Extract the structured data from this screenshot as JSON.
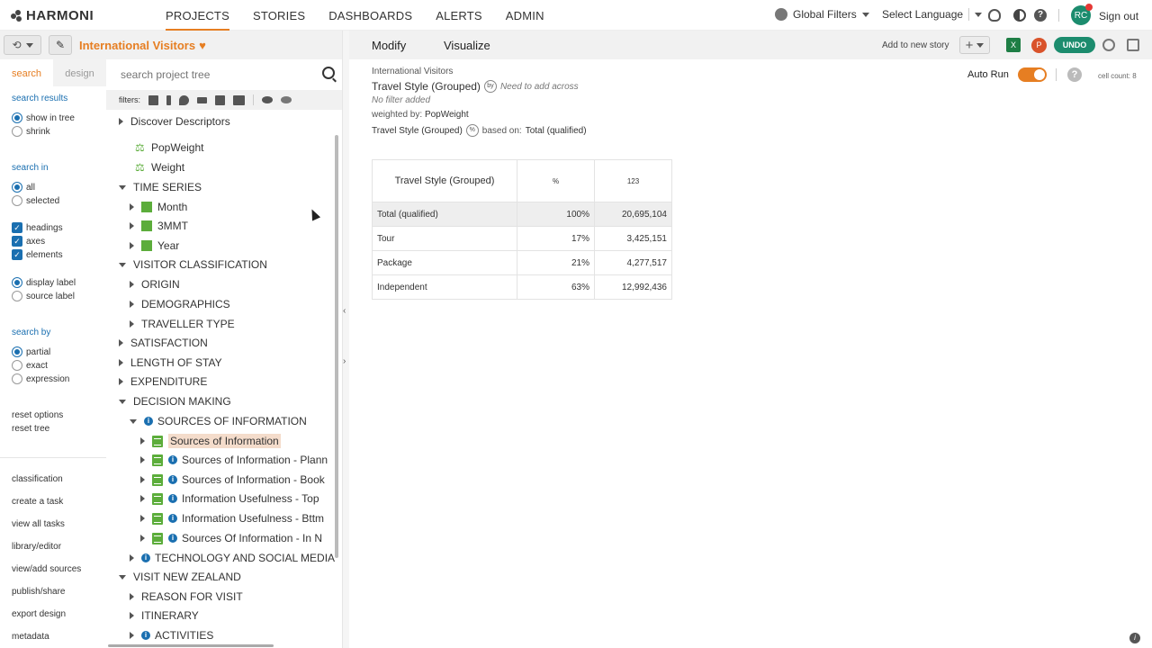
{
  "app": {
    "logo_text": "HARMONI",
    "nav": [
      "PROJECTS",
      "STORIES",
      "DASHBOARDS",
      "ALERTS",
      "ADMIN"
    ],
    "active_nav": "PROJECTS",
    "global_filters": "Global Filters",
    "select_language": "Select Language",
    "user_initials": "RC",
    "sign_out": "Sign out"
  },
  "project": {
    "title": "International Visitors"
  },
  "left_tabs": {
    "search": "search",
    "design": "design"
  },
  "search_panel": {
    "results_heading": "search results",
    "show_in_tree": "show in tree",
    "shrink": "shrink",
    "search_in_heading": "search in",
    "all": "all",
    "selected": "selected",
    "headings": "headings",
    "axes": "axes",
    "elements": "elements",
    "display_label": "display label",
    "source_label": "source label",
    "search_by_heading": "search by",
    "partial": "partial",
    "exact": "exact",
    "expression": "expression",
    "reset_options": "reset options",
    "reset_tree": "reset tree"
  },
  "side_links": [
    "classification",
    "create a task",
    "view all tasks",
    "library/editor",
    "view/add sources",
    "publish/share",
    "export design",
    "metadata"
  ],
  "tree_search": {
    "placeholder": "search project tree",
    "filters_label": "filters:"
  },
  "tree": [
    {
      "label": "Discover Descriptors",
      "level": 0,
      "toggle": "right",
      "icon": ""
    },
    {
      "label": "PopWeight",
      "level": 1,
      "toggle": "",
      "icon": "scale"
    },
    {
      "label": "Weight",
      "level": 1,
      "toggle": "",
      "icon": "scale"
    },
    {
      "label": "TIME SERIES",
      "level": 0,
      "toggle": "down",
      "icon": ""
    },
    {
      "label": "Month",
      "level": 1,
      "toggle": "right",
      "icon": "grid"
    },
    {
      "label": "3MMT",
      "level": 1,
      "toggle": "right",
      "icon": "grid"
    },
    {
      "label": "Year",
      "level": 1,
      "toggle": "right",
      "icon": "grid"
    },
    {
      "label": "VISITOR CLASSIFICATION",
      "level": 0,
      "toggle": "down",
      "icon": ""
    },
    {
      "label": "ORIGIN",
      "level": 1,
      "toggle": "right",
      "icon": ""
    },
    {
      "label": "DEMOGRAPHICS",
      "level": 1,
      "toggle": "right",
      "icon": ""
    },
    {
      "label": "TRAVELLER TYPE",
      "level": 1,
      "toggle": "right",
      "icon": ""
    },
    {
      "label": "SATISFACTION",
      "level": 0,
      "toggle": "right",
      "icon": ""
    },
    {
      "label": "LENGTH OF STAY",
      "level": 0,
      "toggle": "right",
      "icon": ""
    },
    {
      "label": "EXPENDITURE",
      "level": 0,
      "toggle": "right",
      "icon": ""
    },
    {
      "label": "DECISION MAKING",
      "level": 0,
      "toggle": "down",
      "icon": ""
    },
    {
      "label": "SOURCES OF INFORMATION",
      "level": 1,
      "toggle": "down",
      "icon": "info"
    },
    {
      "label": "Sources of Information",
      "level": 2,
      "toggle": "right",
      "icon": "doc",
      "highlight": true
    },
    {
      "label": "Sources of Information - Plann",
      "level": 2,
      "toggle": "right",
      "icon": "doc-info"
    },
    {
      "label": "Sources of Information - Book",
      "level": 2,
      "toggle": "right",
      "icon": "doc-info"
    },
    {
      "label": "Information Usefulness - Top",
      "level": 2,
      "toggle": "right",
      "icon": "doc-info"
    },
    {
      "label": "Information Usefulness - Bttm",
      "level": 2,
      "toggle": "right",
      "icon": "doc-info"
    },
    {
      "label": "Sources Of Information - In N",
      "level": 2,
      "toggle": "right",
      "icon": "doc-info"
    },
    {
      "label": "TECHNOLOGY AND SOCIAL MEDIA",
      "level": 1,
      "toggle": "right",
      "icon": "info"
    },
    {
      "label": "VISIT NEW ZEALAND",
      "level": 0,
      "toggle": "down",
      "icon": ""
    },
    {
      "label": "REASON FOR VISIT",
      "level": 1,
      "toggle": "right",
      "icon": ""
    },
    {
      "label": "ITINERARY",
      "level": 1,
      "toggle": "right",
      "icon": ""
    },
    {
      "label": "ACTIVITIES",
      "level": 1,
      "toggle": "right",
      "icon": "info"
    }
  ],
  "right": {
    "tabs": [
      "Modify",
      "Visualize"
    ],
    "add_to_story": "Add to new story",
    "undo": "UNDO",
    "project_label": "International Visitors",
    "var_title": "Travel Style (Grouped)",
    "by_badge": "by",
    "need_across": "Need to add across",
    "no_filter": "No filter added",
    "weighted_by_label": "weighted by:",
    "weighted_by_value": "PopWeight",
    "based_var": "Travel Style (Grouped)",
    "pct_badge": "%",
    "based_on_label": "based on:",
    "based_on_value": "Total (qualified)",
    "auto_run": "Auto Run",
    "auto_run_on": true,
    "cell_count": "cell count: 8"
  },
  "table": {
    "row_header": "Travel Style (Grouped)",
    "col1": "%",
    "col2": "123",
    "rows": [
      {
        "label": "Total (qualified)",
        "pct": "100%",
        "count": "20,695,104",
        "total": true
      },
      {
        "label": "Tour",
        "pct": "17%",
        "count": "3,425,151"
      },
      {
        "label": "Package",
        "pct": "21%",
        "count": "4,277,517"
      },
      {
        "label": "Independent",
        "pct": "63%",
        "count": "12,992,436"
      }
    ]
  },
  "colors": {
    "accent": "#e67e22",
    "primary": "#1a6fb0",
    "green": "#1c8c6e",
    "tree_icon": "#5cad3b"
  }
}
